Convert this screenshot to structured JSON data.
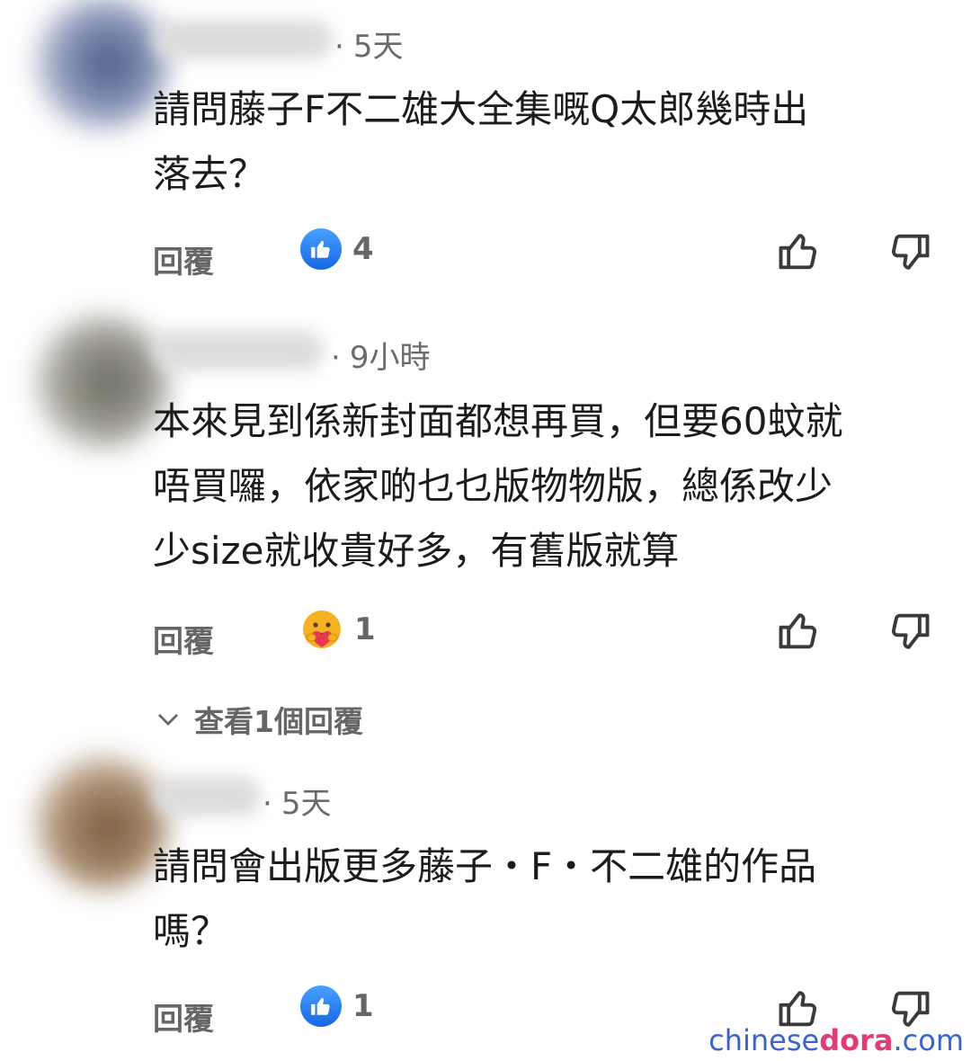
{
  "comments": [
    {
      "time": "5天",
      "text_lines": [
        "請問藤子F不二雄大全集嘅Q太郎幾時出",
        "落去？"
      ],
      "reply_label": "回覆",
      "reaction": {
        "type": "like-icon",
        "count": "4"
      }
    },
    {
      "time": "9小時",
      "text_lines": [
        "本來見到係新封面都想再買，但要60蚊就",
        "唔買囉，依家啲乜乜版物物版，總係改少",
        "少size就收貴好多，有舊版就算"
      ],
      "reply_label": "回覆",
      "reaction": {
        "type": "care-icon",
        "count": "1"
      },
      "view_replies": "查看1個回覆"
    },
    {
      "time": "5天",
      "text_lines": [
        "請問會出版更多藤子・F・不二雄的作品",
        "嗎？"
      ],
      "reply_label": "回覆",
      "reaction": {
        "type": "like-icon",
        "count": "1"
      }
    }
  ],
  "watermark": {
    "part1": "chinese",
    "part2": "dora",
    "part3": ".com"
  },
  "colors": {
    "like_blue": "#1877f2",
    "watermark_blue": "#3a64c8",
    "watermark_pink": "#e03c78",
    "watermark_yellow": "#f0b400"
  }
}
